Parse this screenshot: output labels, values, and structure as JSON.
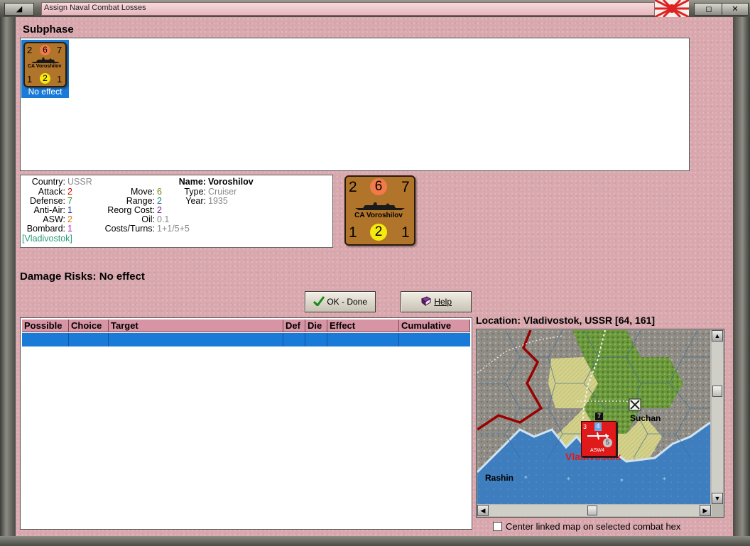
{
  "window": {
    "title": "Assign Naval Combat Losses",
    "minimize_glyph": "◢",
    "maximize_glyph": "◻",
    "close_glyph": "✕"
  },
  "subphase": {
    "title": "Subphase",
    "unit": {
      "attack": "2",
      "defense": "6",
      "move": "7",
      "name": "CA Voroshilov",
      "aa": "1",
      "asw": "2",
      "range": "1",
      "status": "No effect"
    }
  },
  "info": {
    "country_label": "Country:",
    "country": "USSR",
    "attack_label": "Attack:",
    "attack": "2",
    "defense_label": "Defense:",
    "defense": "7",
    "antiair_label": "Anti-Air:",
    "antiair": "1",
    "asw_label": "ASW:",
    "asw": "2",
    "bombard_label": "Bombard:",
    "bombard": "1",
    "location": "[Vladivostok]",
    "move_label": "Move:",
    "move": "6",
    "range_label": "Range:",
    "range": "2",
    "reorg_label": "Reorg Cost:",
    "reorg": "2",
    "oil_label": "Oil:",
    "oil": "0.1",
    "costs_label": "Costs/Turns:",
    "costs": "1+1/5+5",
    "name_label": "Name:",
    "name": "Voroshilov",
    "type_label": "Type:",
    "type": "Cruiser",
    "year_label": "Year:",
    "year": "1935"
  },
  "big_counter": {
    "tl": "2",
    "tc": "6",
    "tr": "7",
    "name": "CA Voroshilov",
    "bl": "1",
    "bc": "2",
    "br": "1"
  },
  "damage": {
    "label": "Damage Risks:",
    "value": "No effect"
  },
  "buttons": {
    "ok": "OK - Done",
    "help": "Help"
  },
  "table": {
    "columns": [
      "Possible",
      "Choice",
      "Target",
      "Def",
      "Die",
      "Effect",
      "Cumulative"
    ]
  },
  "map": {
    "location_label": "Location:",
    "location_value": "Vladivostok, USSR [64, 161]",
    "places": [
      "Suchan",
      "Vladivostok",
      "Rashin"
    ],
    "unit_top": "7",
    "unit_left": "3",
    "unit_mid": "4",
    "unit_right": "5",
    "unit_label": "ASW4"
  },
  "center_checkbox": {
    "label": "Center linked map on selected combat hex",
    "checked": false
  },
  "colors": {
    "panel": "#d9a8ae",
    "selection": "#1a7ad8",
    "counter": "#b0752a",
    "table_header": "#d794a4",
    "attack_red": "#d00000",
    "defense_green": "#2a8a2a",
    "place_red": "#e01818"
  }
}
